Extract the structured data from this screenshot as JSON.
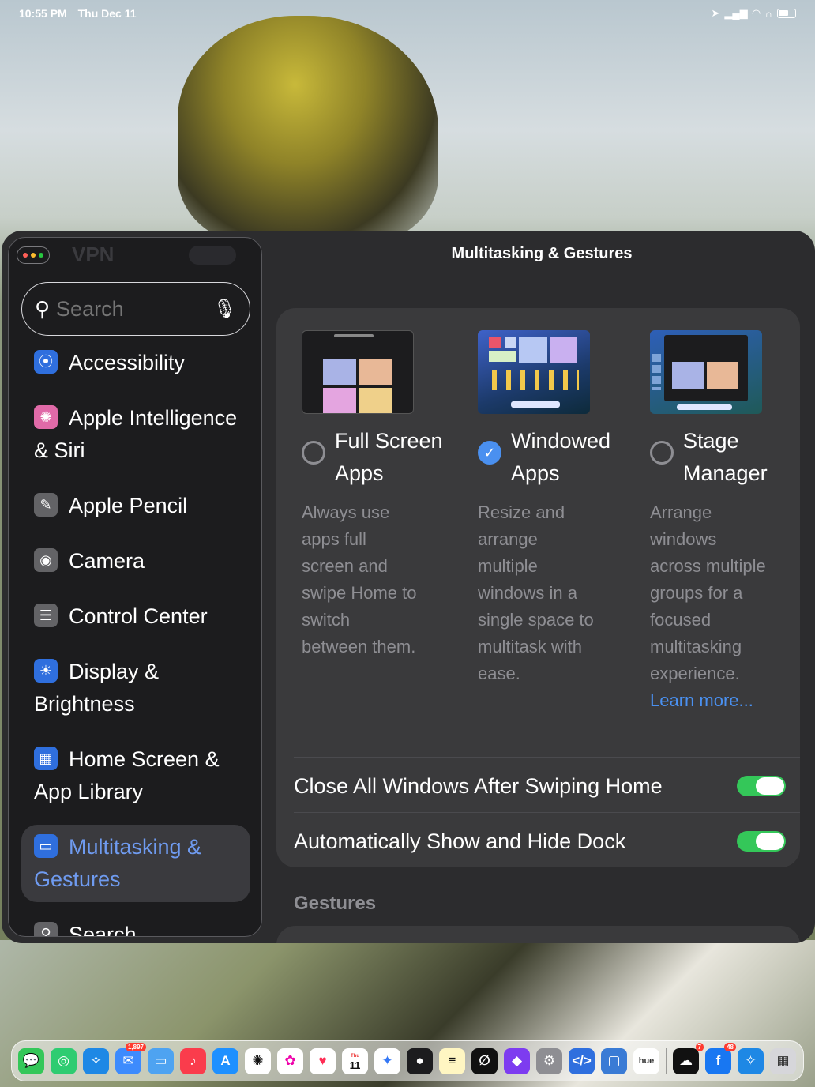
{
  "status_bar": {
    "time": "10:55 PM",
    "date": "Thu Dec 11"
  },
  "sidebar": {
    "ghost_label": "VPN",
    "search_placeholder": "Search",
    "items": [
      {
        "label": "Accessibility",
        "icon": "accessibility-icon",
        "color": "#2f6fde"
      },
      {
        "label": "Apple Intelligence & Siri",
        "icon": "apple-intelligence-icon",
        "color": "#e06aa8"
      },
      {
        "label": "Apple Pencil",
        "icon": "pencil-icon",
        "color": "#636366"
      },
      {
        "label": "Camera",
        "icon": "camera-icon",
        "color": "#636366"
      },
      {
        "label": "Control Center",
        "icon": "control-center-icon",
        "color": "#636366"
      },
      {
        "label": "Display & Brightness",
        "icon": "brightness-icon",
        "color": "#2f6fde"
      },
      {
        "label": "Home Screen & App Library",
        "icon": "home-screen-icon",
        "color": "#2f6fde"
      },
      {
        "label": "Multitasking & Gestures",
        "icon": "multitasking-icon",
        "color": "#2f6fde",
        "selected": true
      },
      {
        "label": "Search",
        "icon": "search-icon",
        "color": "#636366"
      }
    ]
  },
  "main": {
    "title": "Multitasking & Gestures",
    "options": [
      {
        "label": "Full Screen Apps",
        "description": "Always use apps full screen and swipe Home to switch between them.",
        "selected": false
      },
      {
        "label": "Windowed Apps",
        "description": "Resize and arrange multiple windows in a single space to multitask with ease.",
        "selected": true
      },
      {
        "label": "Stage Manager",
        "description": "Arrange windows across multiple groups for a focused multitasking experience.",
        "selected": false,
        "link": "Learn more..."
      }
    ],
    "toggles": [
      {
        "label": "Close All Windows After Swiping Home",
        "on": true
      },
      {
        "label": "Automatically Show and Hide Dock",
        "on": true
      }
    ],
    "section_header": "Gestures"
  },
  "dock": {
    "badges": {
      "mail": "1,897",
      "calendar_day": "11",
      "calendar_weekday": "Thu",
      "soundcloud": "7",
      "facebook": "48"
    },
    "hue_label": "hue"
  },
  "colors": {
    "accent": "#4a90f0",
    "toggle_on": "#34c759"
  }
}
